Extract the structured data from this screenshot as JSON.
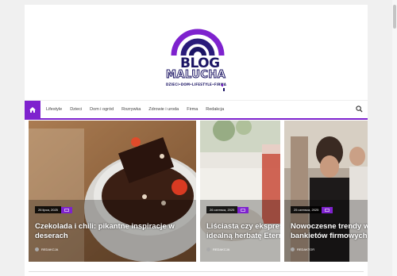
{
  "brand": {
    "name_line1": "BLOG",
    "name_line2": "MALUCHA",
    "tagline": "DZIECI•DOM•LIFESTYLE•FIRMA",
    "colors": {
      "primary": "#7e22ce",
      "dark": "#1b1464"
    }
  },
  "nav": {
    "home_icon": "home-icon",
    "items": [
      {
        "label": "Lifestyle"
      },
      {
        "label": "Dzieci"
      },
      {
        "label": "Dom i ogród"
      },
      {
        "label": "Rozrywka"
      },
      {
        "label": "Zdrowie i uroda"
      },
      {
        "label": "Firma"
      },
      {
        "label": "Redakcja"
      }
    ],
    "search_icon": "search-icon"
  },
  "posts": [
    {
      "date": "26 lipca, 2025",
      "title_line1": "Czekolada i chili: pikantne inspiracje w",
      "title_line2": "deserach",
      "author": "REDAKCJA"
    },
    {
      "date": "26 czerwca, 2025",
      "title_line1": "Liściasta czy ekspres",
      "title_line2": "idealną herbatę Eterna",
      "author": "REDAKCJA"
    },
    {
      "date": "25 czerwca, 2025",
      "title_line1": "Nowoczesne trendy w",
      "title_line2": "bankietów firmowych",
      "author": "REDAKTOR"
    }
  ]
}
